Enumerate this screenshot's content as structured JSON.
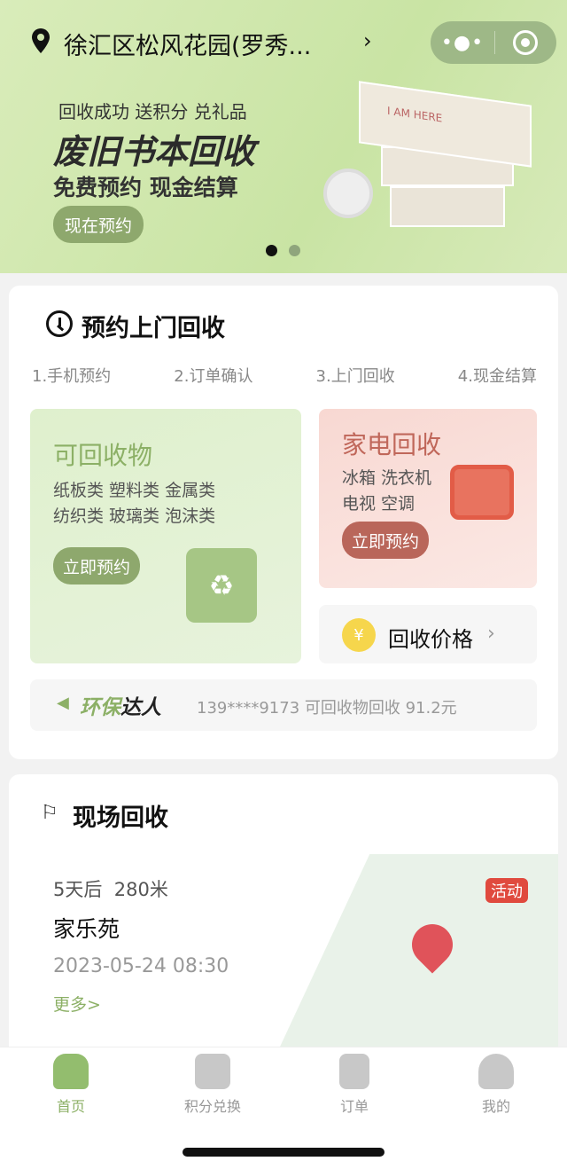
{
  "header": {
    "location": "徐汇区松风花园(罗秀...",
    "chevron": "›",
    "menu_icon": "more-dots-icon",
    "capsule_icon": "target-icon"
  },
  "banner": {
    "tagline": "回收成功 送积分 兑礼品",
    "title": "废旧书本回收",
    "subtitle": "免费预约 现金结算",
    "button": "现在预约",
    "book_text": "I AM HERE",
    "slides": 2,
    "active_slide": 1
  },
  "booking": {
    "title": "预约上门回收",
    "steps": [
      "1.手机预约",
      "2.订单确认",
      "3.上门回收",
      "4.现金结算"
    ],
    "recyclables": {
      "title": "可回收物",
      "line1": "纸板类 塑料类 金属类",
      "line2": "纺织类 玻璃类 泡沫类",
      "button": "立即预约"
    },
    "appliances": {
      "title": "家电回收",
      "line1": "冰箱 洗衣机",
      "line2": "电视 空调",
      "button": "立即预约"
    },
    "price": {
      "label": "回收价格",
      "icon": "¥"
    },
    "ticker": {
      "badge_a": "环保",
      "badge_b": "达人",
      "text": "139****9173 可回收物回收 91.2元"
    }
  },
  "onsite": {
    "title": "现场回收",
    "when": "5天后",
    "distance": "280米",
    "place": "家乐苑",
    "datetime": "2023-05-24 08:30",
    "more": "更多>",
    "tag": "活动"
  },
  "tabbar": {
    "items": [
      {
        "label": "首页",
        "active": true
      },
      {
        "label": "积分兑换"
      },
      {
        "label": "订单"
      },
      {
        "label": "我的"
      }
    ]
  },
  "colors": {
    "accent": "#8cb066",
    "appliance": "#c0675a",
    "tag": "#e04a3e"
  }
}
